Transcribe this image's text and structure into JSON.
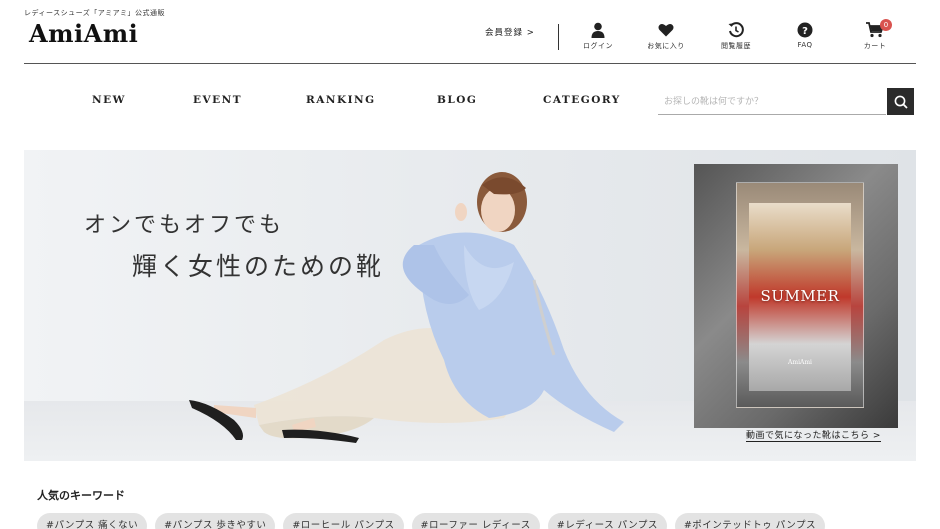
{
  "header": {
    "tagline": "レディースシューズ「アミアミ」公式通販",
    "logo": "AmiAmi",
    "register": "会員登録 >",
    "icons": [
      {
        "icon": "person-icon",
        "label": "ログイン"
      },
      {
        "icon": "heart-icon",
        "label": "お気に入り"
      },
      {
        "icon": "history-icon",
        "label": "閲覧履歴"
      },
      {
        "icon": "help-icon",
        "label": "FAQ"
      },
      {
        "icon": "cart-icon",
        "label": "カート",
        "badge": "0"
      }
    ]
  },
  "nav": {
    "items": [
      "NEW",
      "EVENT",
      "RANKING",
      "BLOG",
      "CATEGORY"
    ],
    "search_placeholder": "お探しの靴は何ですか？"
  },
  "hero": {
    "line1": "オンでもオフでも",
    "line2": "輝く女性のための靴",
    "card_title": "SUMMER",
    "card_brand": "AmiAmi",
    "video_link": "動画で気になった靴はこちら >"
  },
  "keywords": {
    "title": "人気のキーワード",
    "items": [
      "#パンプス 痛くない",
      "#パンプス 歩きやすい",
      "#ローヒール パンプス",
      "#ローファー レディース",
      "#レディース パンプス",
      "#ポインテッドトゥ パンプス"
    ]
  },
  "colors": {
    "dark": "#2b2b2b",
    "badge": "#d9534f",
    "chip": "#e3e3e3"
  }
}
